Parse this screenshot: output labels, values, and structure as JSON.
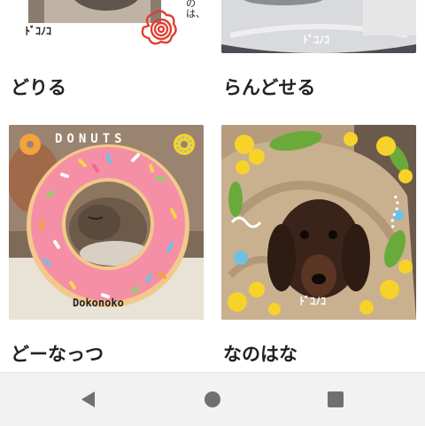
{
  "grid": {
    "items": [
      {
        "title": "どりる",
        "thumb_stamp": "ﾄﾞｺﾉｺ",
        "thumb_caption": "のは、"
      },
      {
        "title": "らんどせる",
        "thumb_stamp": "ﾄﾞｺﾉｺ"
      },
      {
        "title": "どーなっつ",
        "thumb_stamp": "Dokonoko",
        "thumb_banner": "DONUTS"
      },
      {
        "title": "なのはな",
        "thumb_stamp": "ﾄﾞｺﾉｺ"
      }
    ]
  },
  "navigation_bar": {
    "buttons": [
      {
        "icon": "back-triangle-icon"
      },
      {
        "icon": "home-circle-icon"
      },
      {
        "icon": "recents-square-icon"
      }
    ]
  },
  "colors": {
    "background": "#ffffff",
    "nav_bar": "#f2f2f2",
    "nav_icon": "#707070",
    "donut_pink": "#f58fa5",
    "donut_dough": "#f2c98a",
    "blanket": "#c9b08f",
    "leaf_green": "#6aaa3a",
    "flower_yellow": "#f7d22b"
  }
}
